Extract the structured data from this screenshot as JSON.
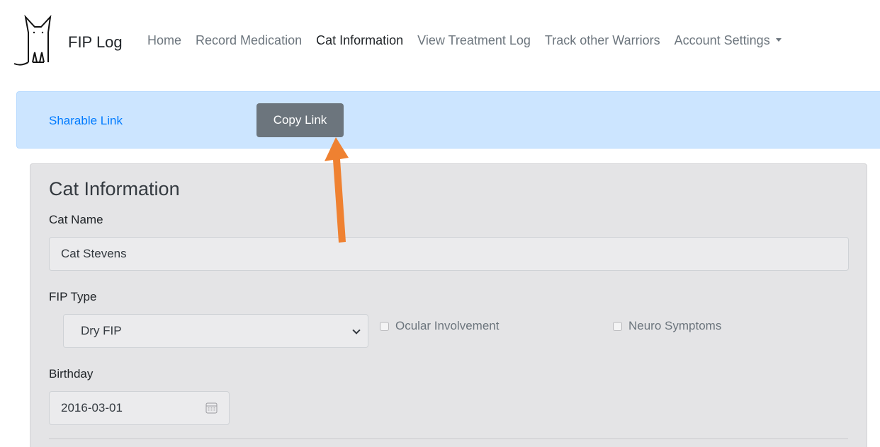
{
  "navbar": {
    "brand": "FIP Log",
    "items": [
      {
        "label": "Home",
        "active": false
      },
      {
        "label": "Record Medication",
        "active": false
      },
      {
        "label": "Cat Information",
        "active": true
      },
      {
        "label": "View Treatment Log",
        "active": false
      },
      {
        "label": "Track other Warriors",
        "active": false
      },
      {
        "label": "Account Settings",
        "active": false
      }
    ],
    "account_dropdown_icon": "caret-down-icon"
  },
  "alert": {
    "link_label": "Sharable Link",
    "button_label": "Copy Link"
  },
  "card": {
    "title": "Cat Information",
    "cat_name": {
      "label": "Cat Name",
      "value": "Cat Stevens"
    },
    "fip_type": {
      "label": "FIP Type",
      "selected": "Dry FIP"
    },
    "ocular": {
      "label": "Ocular Involvement",
      "checked": false
    },
    "neuro": {
      "label": "Neuro Symptoms",
      "checked": false
    },
    "birthday": {
      "label": "Birthday",
      "value": "2016-03-01"
    }
  },
  "colors": {
    "alert_bg": "#cce5ff",
    "link": "#007bff",
    "button_bg": "#6c757d",
    "annotation_arrow": "#ef8131"
  },
  "icons": {
    "logo": "cat-logo-icon",
    "select": "chevron-down-icon",
    "calendar": "calendar-icon",
    "annotation": "orange-arrow-icon"
  }
}
